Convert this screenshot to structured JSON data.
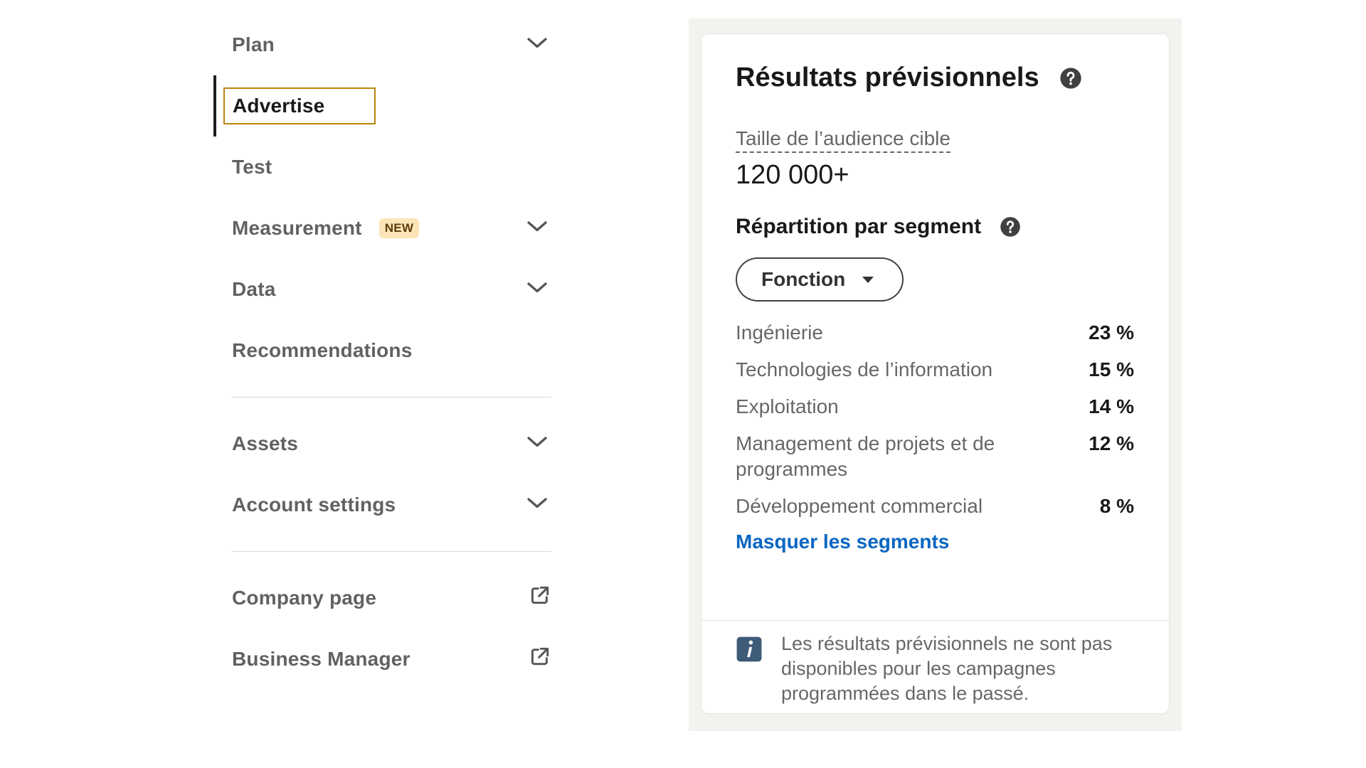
{
  "sidebar": {
    "items": [
      {
        "label": "Plan",
        "chevron": "chevron-down-icon"
      },
      {
        "label": "Advertise",
        "active": true
      },
      {
        "label": "Test"
      },
      {
        "label": "Measurement",
        "badge": "NEW",
        "chevron": "chevron-down-icon"
      },
      {
        "label": "Data",
        "chevron": "chevron-down-icon"
      },
      {
        "label": "Recommendations"
      }
    ],
    "group2": [
      {
        "label": "Assets",
        "chevron": "chevron-down-icon"
      },
      {
        "label": "Account settings",
        "chevron": "chevron-down-icon"
      }
    ],
    "group3": [
      {
        "label": "Company page",
        "icon": "external-link-icon"
      },
      {
        "label": "Business Manager",
        "icon": "external-link-icon"
      }
    ]
  },
  "forecast": {
    "title": "Résultats prévisionnels",
    "audience_label": "Taille de l’audience cible",
    "audience_value": "120 000+",
    "segment_title": "Répartition par segment",
    "dropdown_value": "Fonction",
    "segments": [
      {
        "name": "Ingénierie",
        "pct": "23 %"
      },
      {
        "name": "Technologies de l’information",
        "pct": "15 %"
      },
      {
        "name": "Exploitation",
        "pct": "14 %"
      },
      {
        "name": "Management de projets et de programmes",
        "pct": "12 %"
      },
      {
        "name": "Développement commercial",
        "pct": "8 %"
      }
    ],
    "hide_link": "Masquer les segments",
    "info_text": "Les résultats prévisionnels ne sont pas disponibles pour les campagnes programmées dans le passé."
  },
  "colors": {
    "accent_link": "#0a66c2",
    "active_outline": "#b8860b",
    "badge_bg": "#fbe4b8",
    "panel_bg": "#f3f2ef",
    "info_icon": "#3e5b78"
  }
}
